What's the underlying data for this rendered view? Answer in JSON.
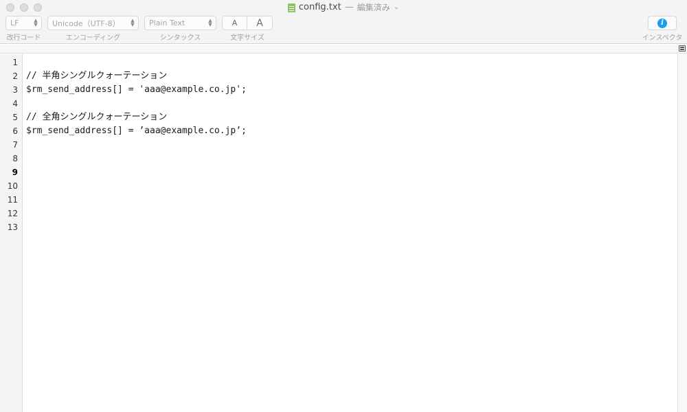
{
  "window": {
    "file_name": "config.txt",
    "separator": "—",
    "status": "編集済み",
    "chevron": "⌄"
  },
  "toolbar": {
    "line_ending": {
      "value": "LF",
      "label": "改行コード"
    },
    "encoding": {
      "value": "Unicode（UTF-8）",
      "label": "エンコーディング"
    },
    "syntax": {
      "value": "Plain Text",
      "label": "シンタックス"
    },
    "font_size": {
      "smaller": "A",
      "larger": "A",
      "label": "文字サイズ"
    },
    "inspector": {
      "icon": "i",
      "label": "インスペクタ"
    }
  },
  "editor": {
    "current_line": 9,
    "lines": [
      "",
      "// 半角シングルクォーテーション",
      "$rm_send_address[] = 'aaa@example.co.jp';",
      "",
      "// 全角シングルクォーテーション",
      "$rm_send_address[] = ’aaa@example.co.jp’;",
      "",
      "",
      "",
      "",
      "",
      "",
      ""
    ],
    "line_numbers": [
      "1",
      "2",
      "3",
      "4",
      "5",
      "6",
      "7",
      "8",
      "9",
      "10",
      "11",
      "12",
      "13"
    ]
  },
  "colors": {
    "toolbar_bg": "#f4f4f4",
    "gutter_bg": "#f5f5f5",
    "inspector_accent": "#1f9bf0",
    "doc_icon": "#8dc56b"
  }
}
